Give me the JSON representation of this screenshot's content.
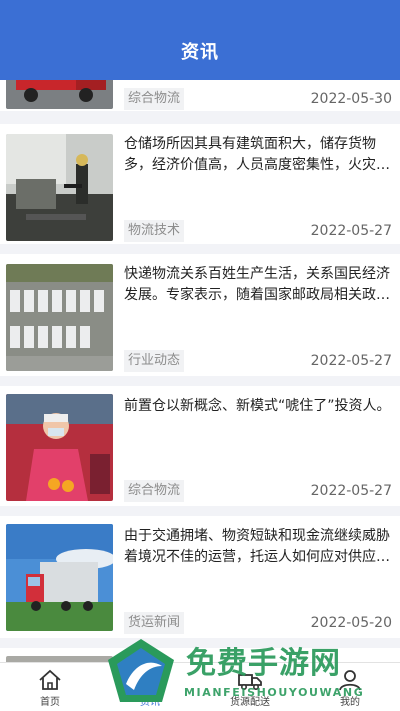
{
  "header": {
    "title": "资讯"
  },
  "articles": [
    {
      "text": "",
      "tag": "综合物流",
      "date": "2022-05-30",
      "image": "red-truck-image"
    },
    {
      "text": "仓储场所因其具有建筑面积大，储存货物多，经济价值高，人员高度密集性，火灾风险大等特点",
      "tag": "物流技术",
      "date": "2022-05-27",
      "image": "firefighter-image"
    },
    {
      "text": "快递物流关系百姓生产生活，关系国民经济发展。专家表示，随着国家邮政局相关政策的落实",
      "tag": "行业动态",
      "date": "2022-05-27",
      "image": "trucks-aerial-image"
    },
    {
      "text": "前置仓以新概念、新模式“唬住了”投资人。",
      "tag": "综合物流",
      "date": "2022-05-27",
      "image": "delivery-worker-image"
    },
    {
      "text": "由于交通拥堵、物资短缺和现金流继续威胁着境况不佳的运营，托运人如何应对供应链挑战",
      "tag": "货运新闻",
      "date": "2022-05-20",
      "image": "cargo-truck-image"
    }
  ],
  "tabbar": {
    "items": [
      {
        "label": "首页",
        "icon": "home-icon"
      },
      {
        "label": "资讯",
        "icon": "news-icon"
      },
      {
        "label": "货源配送",
        "icon": "truck-icon"
      },
      {
        "label": "我的",
        "icon": "user-icon"
      }
    ]
  },
  "watermark": {
    "cn": "免费手游网",
    "en": "MIANFEISHOUYOUWANG"
  },
  "colors": {
    "primary": "#3b6fd4",
    "background": "#f2f3f7",
    "watermark": "#2a9a5b"
  }
}
